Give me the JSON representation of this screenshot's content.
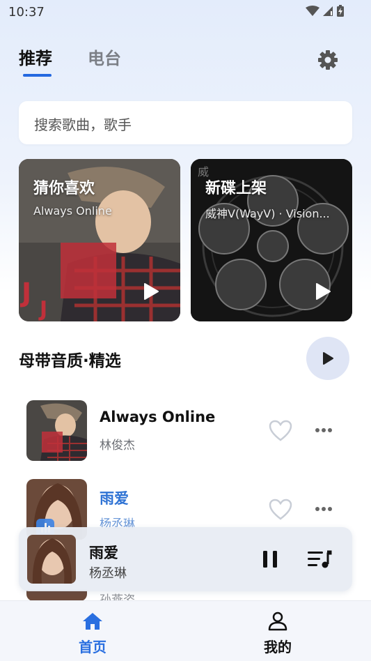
{
  "status_bar": {
    "time": "10:37"
  },
  "tabs": [
    {
      "label": "推荐",
      "active": true
    },
    {
      "label": "电台",
      "active": false
    }
  ],
  "search": {
    "placeholder": "搜索歌曲，歌手"
  },
  "cards": [
    {
      "title": "猜你喜欢",
      "subtitle": "Always Online"
    },
    {
      "title": "新碟上架",
      "subtitle": "威神V(WayV) · Vision..."
    }
  ],
  "section": {
    "title": "母带音质·精选"
  },
  "songs": [
    {
      "title": "Always Online",
      "artist": "林俊杰",
      "playing": false
    },
    {
      "title": "雨爱",
      "artist": "杨丞琳",
      "playing": true
    },
    {
      "title": "",
      "artist": "孙燕姿",
      "playing": false
    }
  ],
  "mini_player": {
    "title": "雨爱",
    "artist": "杨丞琳",
    "state": "playing"
  },
  "bottom_nav": [
    {
      "label": "首页",
      "icon": "home-icon",
      "active": true
    },
    {
      "label": "我的",
      "icon": "person-icon",
      "active": false
    }
  ],
  "colors": {
    "accent": "#2a6fe0",
    "active_song": "#2f73d4"
  }
}
